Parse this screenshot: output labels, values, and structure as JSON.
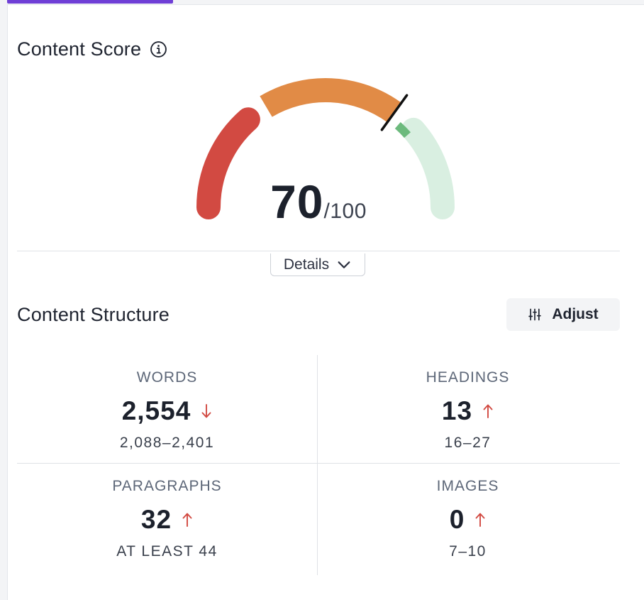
{
  "content_score": {
    "title": "Content Score",
    "info_icon": "info-circle-icon",
    "value": "70",
    "max": "/100",
    "gauge": {
      "score": 70,
      "max": 100,
      "target_range": [
        73,
        77
      ],
      "colors": {
        "low": "#d24a42",
        "medium": "#e18b46",
        "target": "#6cba7d",
        "remaining": "#d9efe1",
        "needle": "#111111"
      }
    }
  },
  "details_button": {
    "label": "Details",
    "icon": "chevron-down-icon"
  },
  "content_structure": {
    "title": "Content Structure",
    "adjust_button": {
      "label": "Adjust",
      "icon": "sliders-icon"
    },
    "metrics": [
      {
        "label": "WORDS",
        "value": "2,554",
        "trend": "down",
        "range": "2,088–2,401"
      },
      {
        "label": "HEADINGS",
        "value": "13",
        "trend": "up",
        "range": "16–27"
      },
      {
        "label": "PARAGRAPHS",
        "value": "32",
        "trend": "up",
        "range": "AT LEAST 44"
      },
      {
        "label": "IMAGES",
        "value": "0",
        "trend": "up",
        "range": "7–10"
      }
    ]
  },
  "colors": {
    "accent": "#6f3fd6",
    "trend_arrow": "#d24a42"
  }
}
